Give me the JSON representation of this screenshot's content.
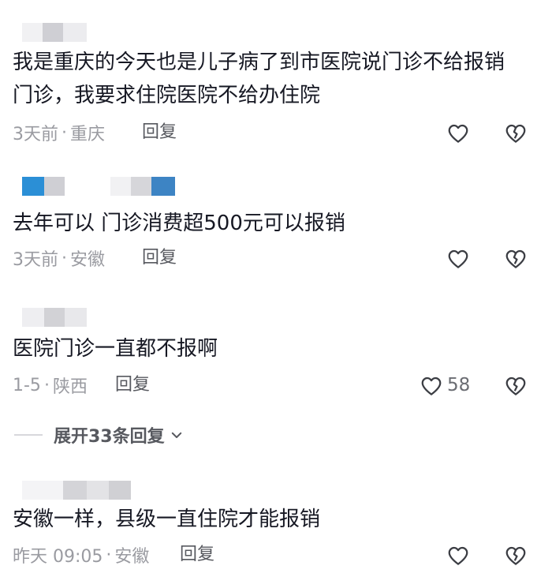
{
  "comments": [
    {
      "text_lines": [
        "我是重庆的今天也是儿子病了到市医院说门诊不给报销",
        "门诊，我要求住院医院不给办住院"
      ],
      "time": "3天前",
      "location": "重庆",
      "reply_label": "回复",
      "like_count": ""
    },
    {
      "text_lines": [
        "去年可以 门诊消费超500元可以报销"
      ],
      "time": "3天前",
      "location": "安徽",
      "reply_label": "回复",
      "like_count": ""
    },
    {
      "text_lines": [
        "医院门诊一直都不报啊"
      ],
      "time": "1-5",
      "location": "陕西",
      "reply_label": "回复",
      "like_count": "58"
    },
    {
      "text_lines": [
        "安徽一样，县级一直住院才能报销"
      ],
      "time": "昨天 09:05",
      "location": "安徽",
      "reply_label": "回复",
      "like_count": ""
    }
  ],
  "expand_replies": {
    "label": "展开33条回复"
  },
  "meta_separator": "·",
  "icons": {
    "like": "heart-outline-icon",
    "dislike": "broken-heart-icon",
    "expand": "chevron-down-icon"
  },
  "colors": {
    "text": "#161823",
    "meta": "#9a9ba1",
    "reply": "#57595f",
    "blurred_avatar_blue": "#2b8fd6"
  }
}
